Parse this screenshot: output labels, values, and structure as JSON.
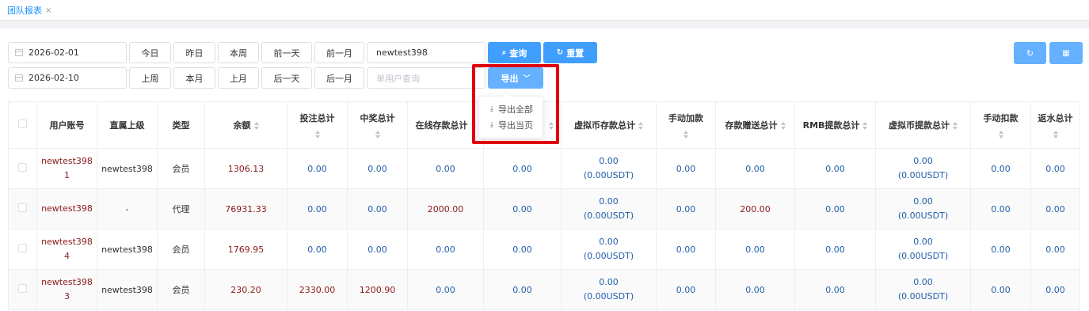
{
  "tab": {
    "label": "团队报表",
    "close": "×"
  },
  "filters": {
    "start_date": "2026-02-01",
    "end_date": "2026-02-10",
    "row1_buttons": [
      "今日",
      "昨日",
      "本周",
      "前一天",
      "前一月"
    ],
    "row2_buttons": [
      "上周",
      "本月",
      "上月",
      "后一天",
      "后一月"
    ],
    "username_value": "newtest398",
    "single_user_placeholder": "单用户查询",
    "search_label": "查询",
    "reset_label": "重置",
    "export_label": "导出"
  },
  "export_menu": {
    "items": [
      "导出全部",
      "导出当页"
    ]
  },
  "colors": {
    "primary": "#409eff",
    "light_primary": "#66b1ff",
    "highlight": "#e0000b",
    "red_text": "#8b1a1a",
    "blue_text": "#1f5fa8"
  },
  "table": {
    "headers": [
      "用户账号",
      "直属上级",
      "类型",
      "余额",
      "投注总计",
      "中奖总计",
      "在线存款总计",
      "",
      "虚拟币存款总计",
      "手动加款",
      "存款赠送总计",
      "RMB提款总计",
      "虚拟币提款总计",
      "手动扣款",
      "返水总计"
    ],
    "rows": [
      {
        "account_line1": "newtest398",
        "account_line2": "1",
        "parent": "newtest398",
        "type": "会员",
        "balance": "1306.13",
        "bet": "0.00",
        "win": "0.00",
        "online_deposit": "0.00",
        "col8": "0.00",
        "crypto_deposit": "0.00",
        "crypto_deposit_usdt": "(0.00USDT)",
        "manual_add": "0.00",
        "deposit_bonus": "0.00",
        "rmb_withdraw": "0.00",
        "crypto_withdraw": "0.00",
        "crypto_withdraw_usdt": "(0.00USDT)",
        "manual_deduct": "0.00",
        "rebate": "0.00"
      },
      {
        "account_line1": "newtest398",
        "account_line2": "",
        "parent": "-",
        "type": "代理",
        "balance": "76931.33",
        "bet": "0.00",
        "win": "0.00",
        "online_deposit": "2000.00",
        "col8": "0.00",
        "crypto_deposit": "0.00",
        "crypto_deposit_usdt": "(0.00USDT)",
        "manual_add": "0.00",
        "deposit_bonus": "200.00",
        "rmb_withdraw": "0.00",
        "crypto_withdraw": "0.00",
        "crypto_withdraw_usdt": "(0.00USDT)",
        "manual_deduct": "0.00",
        "rebate": "0.00"
      },
      {
        "account_line1": "newtest398",
        "account_line2": "4",
        "parent": "newtest398",
        "type": "会员",
        "balance": "1769.95",
        "bet": "0.00",
        "win": "0.00",
        "online_deposit": "0.00",
        "col8": "0.00",
        "crypto_deposit": "0.00",
        "crypto_deposit_usdt": "(0.00USDT)",
        "manual_add": "0.00",
        "deposit_bonus": "0.00",
        "rmb_withdraw": "0.00",
        "crypto_withdraw": "0.00",
        "crypto_withdraw_usdt": "(0.00USDT)",
        "manual_deduct": "0.00",
        "rebate": "0.00"
      },
      {
        "account_line1": "newtest398",
        "account_line2": "3",
        "parent": "newtest398",
        "type": "会员",
        "balance": "230.20",
        "bet": "2330.00",
        "win": "1200.90",
        "online_deposit": "0.00",
        "col8": "0.00",
        "crypto_deposit": "0.00",
        "crypto_deposit_usdt": "(0.00USDT)",
        "manual_add": "0.00",
        "deposit_bonus": "0.00",
        "rmb_withdraw": "0.00",
        "crypto_withdraw": "0.00",
        "crypto_withdraw_usdt": "(0.00USDT)",
        "manual_deduct": "0.00",
        "rebate": "0.00"
      }
    ]
  }
}
